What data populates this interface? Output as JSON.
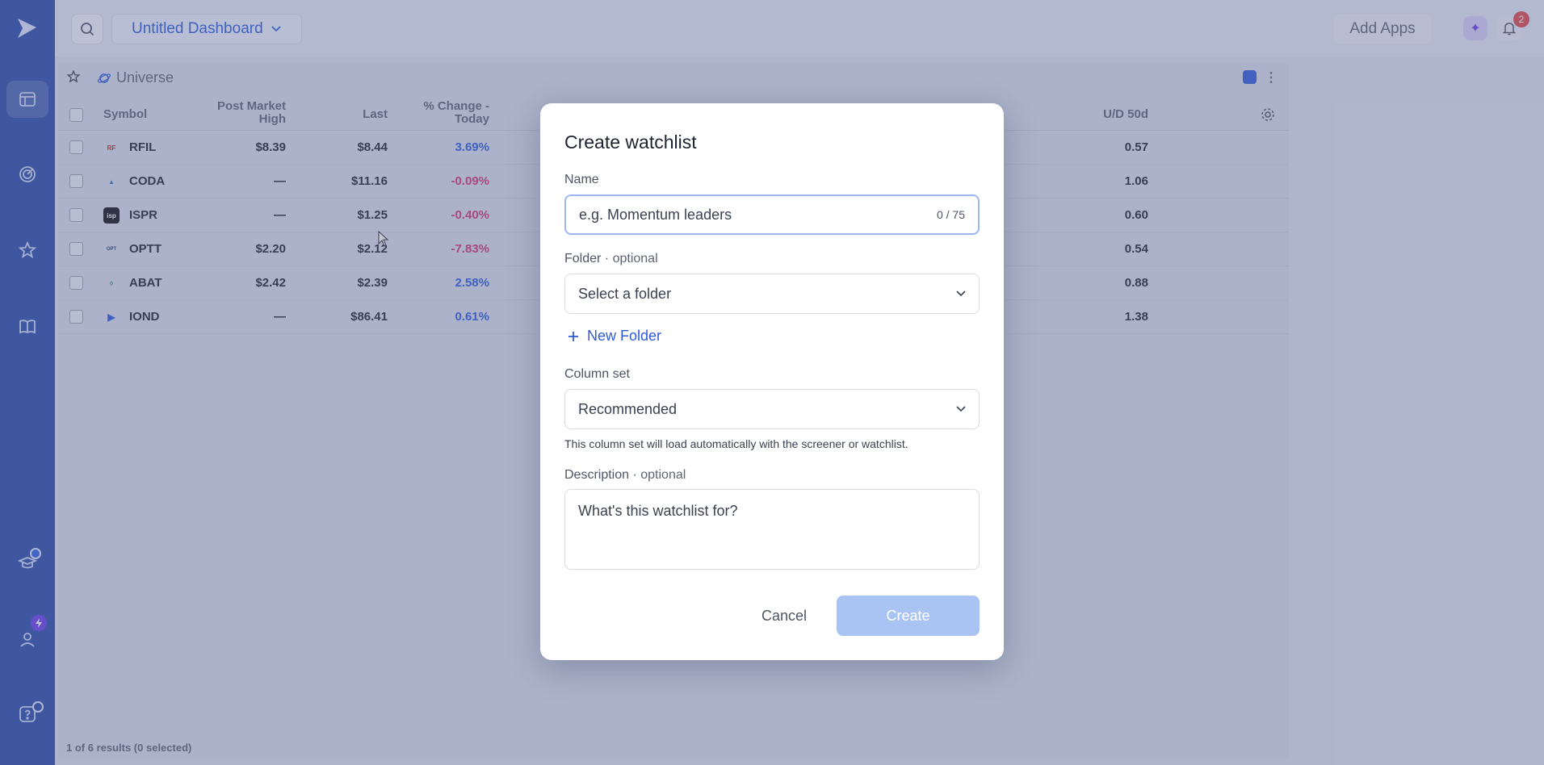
{
  "topbar": {
    "dashboard_title": "Untitled Dashboard",
    "add_apps_label": "Add Apps",
    "notification_count": "2"
  },
  "panel": {
    "title": "Universe",
    "footer": "1 of 6 results (0 selected)"
  },
  "table": {
    "headers": {
      "symbol": "Symbol",
      "post_market_high_line1": "Post Market",
      "post_market_high_line2": "High",
      "last": "Last",
      "pct_change_line1": "% Change -",
      "pct_change_line2": "Today",
      "ud50": "U/D 50d"
    },
    "rows": [
      {
        "symbol": "RFIL",
        "pmh": "$8.39",
        "last": "$8.44",
        "chg": "3.69%",
        "ud": "0.57",
        "dir": "pos"
      },
      {
        "symbol": "CODA",
        "pmh": "—",
        "last": "$11.16",
        "chg": "-0.09%",
        "ud": "1.06",
        "dir": "neg"
      },
      {
        "symbol": "ISPR",
        "pmh": "—",
        "last": "$1.25",
        "chg": "-0.40%",
        "ud": "0.60",
        "dir": "neg"
      },
      {
        "symbol": "OPTT",
        "pmh": "$2.20",
        "last": "$2.12",
        "chg": "-7.83%",
        "ud": "0.54",
        "dir": "neg"
      },
      {
        "symbol": "ABAT",
        "pmh": "$2.42",
        "last": "$2.39",
        "chg": "2.58%",
        "ud": "0.88",
        "dir": "pos"
      },
      {
        "symbol": "IOND",
        "pmh": "—",
        "last": "$86.41",
        "chg": "0.61%",
        "ud": "1.38",
        "dir": "pos"
      }
    ]
  },
  "modal": {
    "title": "Create watchlist",
    "name_label": "Name",
    "name_placeholder": "e.g. Momentum leaders",
    "name_counter": "0 / 75",
    "folder_label": "Folder",
    "folder_optional": " · optional",
    "folder_placeholder": "Select a folder",
    "new_folder_label": "New Folder",
    "column_set_label": "Column set",
    "column_set_value": "Recommended",
    "column_set_hint": "This column set will load automatically with the screener or watchlist.",
    "description_label": "Description",
    "description_optional": " · optional",
    "description_placeholder": "What's this watchlist for?",
    "cancel_label": "Cancel",
    "create_label": "Create"
  },
  "colors": {
    "accent": "#2f5bd8",
    "positive": "#2f5bd8",
    "negative": "#d6337a",
    "sidebar": "#2b4aa6"
  }
}
